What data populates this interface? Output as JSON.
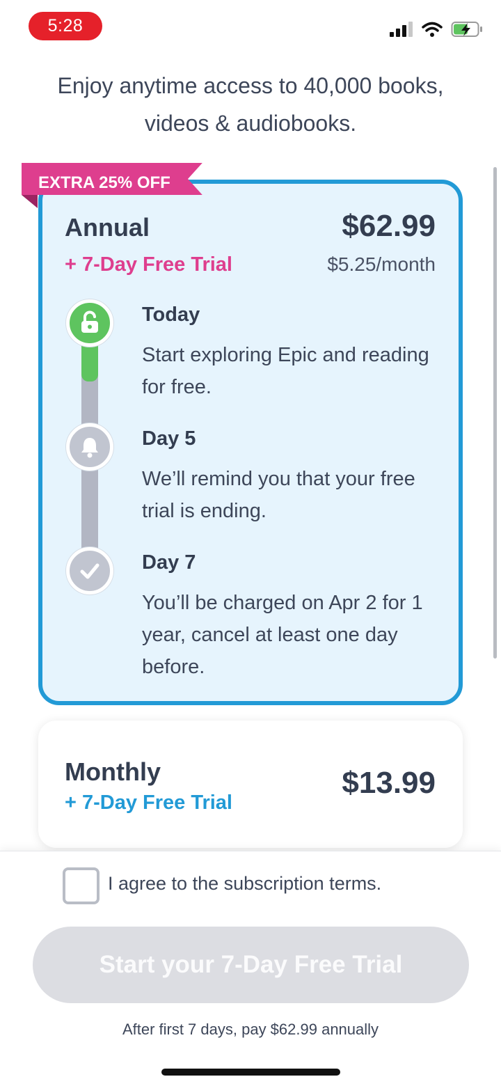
{
  "status_bar": {
    "time": "5:28"
  },
  "headline": "Enjoy anytime access to 40,000 books, videos & audiobooks.",
  "annual": {
    "badge": "EXTRA 25% OFF",
    "name": "Annual",
    "trial": "+ 7-Day Free Trial",
    "price": "$62.99",
    "per_month": "$5.25/month",
    "steps": [
      {
        "title": "Today",
        "text": "Start exploring Epic and reading for free.",
        "icon": "unlock-icon"
      },
      {
        "title": "Day 5",
        "text": "We’ll remind you that your free trial is ending.",
        "icon": "bell-icon"
      },
      {
        "title": "Day 7",
        "text": "You’ll be charged on Apr 2 for 1 year, cancel at least one day before.",
        "icon": "check-icon"
      }
    ]
  },
  "monthly": {
    "name": "Monthly",
    "trial": "+ 7-Day Free Trial",
    "price": "$13.99"
  },
  "agree_label": "I agree to the subscription terms.",
  "cta_label": "Start your 7-Day Free Trial",
  "footnote": "After first 7 days, pay $62.99 annually",
  "colors": {
    "accent_blue": "#229ad6",
    "accent_pink": "#de3e8e",
    "green": "#5ec45f",
    "time_red": "#e5212a"
  }
}
